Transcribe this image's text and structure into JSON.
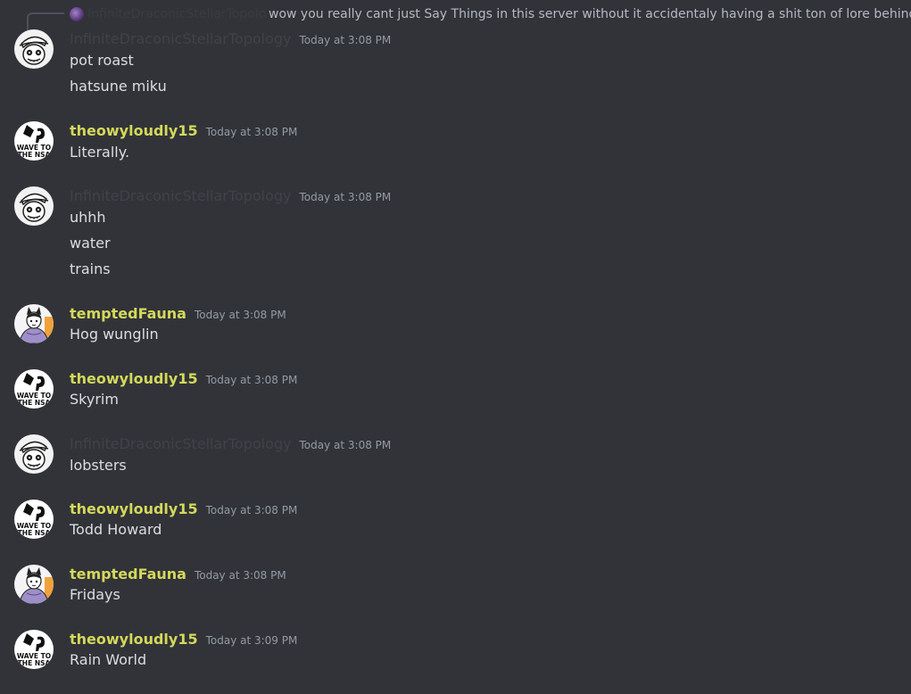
{
  "reply": {
    "author": "InfiniteDraconicStellarTopology",
    "text": "wow you really cant just Say Things in this server without it accidentaly having a shit ton of lore behind it"
  },
  "colors": {
    "background": "#313338",
    "username_yellow": "#d4d95a",
    "username_dim": "#404249",
    "timestamp": "#949ba4",
    "message_text": "#dbdee1"
  },
  "messages": [
    {
      "author": "InfiniteDraconicStellarTopology",
      "timestamp": "Today at 3:08 PM",
      "avatar": "sketch-face-icon",
      "lines": [
        "pot roast",
        "hatsune miku"
      ]
    },
    {
      "author": "theowyloudly15",
      "timestamp": "Today at 3:08 PM",
      "avatar": "wave-to-the-nsa-icon",
      "lines": [
        "Literally."
      ]
    },
    {
      "author": "InfiniteDraconicStellarTopology",
      "timestamp": "Today at 3:08 PM",
      "avatar": "sketch-face-icon",
      "lines": [
        "uhhh",
        "water",
        "trains"
      ]
    },
    {
      "author": "temptedFauna",
      "timestamp": "Today at 3:08 PM",
      "avatar": "cat-character-icon",
      "lines": [
        "Hog wunglin"
      ]
    },
    {
      "author": "theowyloudly15",
      "timestamp": "Today at 3:08 PM",
      "avatar": "wave-to-the-nsa-icon",
      "lines": [
        "Skyrim"
      ]
    },
    {
      "author": "InfiniteDraconicStellarTopology",
      "timestamp": "Today at 3:08 PM",
      "avatar": "sketch-face-icon",
      "lines": [
        "lobsters"
      ]
    },
    {
      "author": "theowyloudly15",
      "timestamp": "Today at 3:08 PM",
      "avatar": "wave-to-the-nsa-icon",
      "lines": [
        "Todd Howard"
      ]
    },
    {
      "author": "temptedFauna",
      "timestamp": "Today at 3:08 PM",
      "avatar": "cat-character-icon",
      "lines": [
        "Fridays"
      ]
    },
    {
      "author": "theowyloudly15",
      "timestamp": "Today at 3:09 PM",
      "avatar": "wave-to-the-nsa-icon",
      "lines": [
        "Rain World"
      ]
    }
  ],
  "avatar_text": {
    "wave_line1": "WAVE TO",
    "wave_line2": "THE NSA"
  }
}
